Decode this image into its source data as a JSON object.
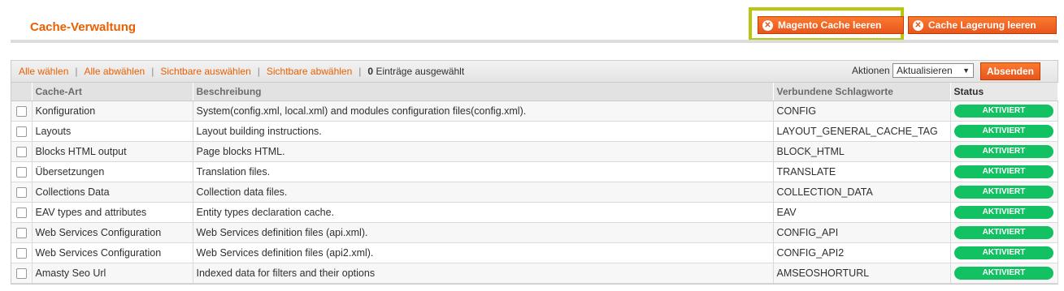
{
  "page": {
    "title": "Cache-Verwaltung",
    "buttons": {
      "flush_magento": "Magento Cache leeren",
      "flush_storage": "Cache Lagerung leeren"
    }
  },
  "massaction": {
    "select_all": "Alle wählen",
    "unselect_all": "Alle abwählen",
    "select_visible": "Sichtbare auswählen",
    "unselect_visible": "Sichtbare abwählen",
    "selected_count": "0",
    "selected_label": "Einträge ausgewählt",
    "actions_label": "Aktionen",
    "actions_value": "Aktualisieren",
    "submit_label": "Absenden"
  },
  "grid": {
    "columns": [
      "Cache-Art",
      "Beschreibung",
      "Verbundene Schlagworte",
      "Status"
    ],
    "rows": [
      {
        "type": "Konfiguration",
        "description": "System(config.xml, local.xml) and modules configuration files(config.xml).",
        "tags": "CONFIG",
        "status": "AKTIVIERT"
      },
      {
        "type": "Layouts",
        "description": "Layout building instructions.",
        "tags": "LAYOUT_GENERAL_CACHE_TAG",
        "status": "AKTIVIERT"
      },
      {
        "type": "Blocks HTML output",
        "description": "Page blocks HTML.",
        "tags": "BLOCK_HTML",
        "status": "AKTIVIERT"
      },
      {
        "type": "Übersetzungen",
        "description": "Translation files.",
        "tags": "TRANSLATE",
        "status": "AKTIVIERT"
      },
      {
        "type": "Collections Data",
        "description": "Collection data files.",
        "tags": "COLLECTION_DATA",
        "status": "AKTIVIERT"
      },
      {
        "type": "EAV types and attributes",
        "description": "Entity types declaration cache.",
        "tags": "EAV",
        "status": "AKTIVIERT"
      },
      {
        "type": "Web Services Configuration",
        "description": "Web Services definition files (api.xml).",
        "tags": "CONFIG_API",
        "status": "AKTIVIERT"
      },
      {
        "type": "Web Services Configuration",
        "description": "Web Services definition files (api2.xml).",
        "tags": "CONFIG_API2",
        "status": "AKTIVIERT"
      },
      {
        "type": "Amasty Seo Url",
        "description": "Indexed data for filters and their options",
        "tags": "AMSEOSHORTURL",
        "status": "AKTIVIERT"
      }
    ]
  },
  "colors": {
    "accent": "#eb5e00",
    "status_enabled": "#12c162",
    "highlight": "#b8c610"
  }
}
